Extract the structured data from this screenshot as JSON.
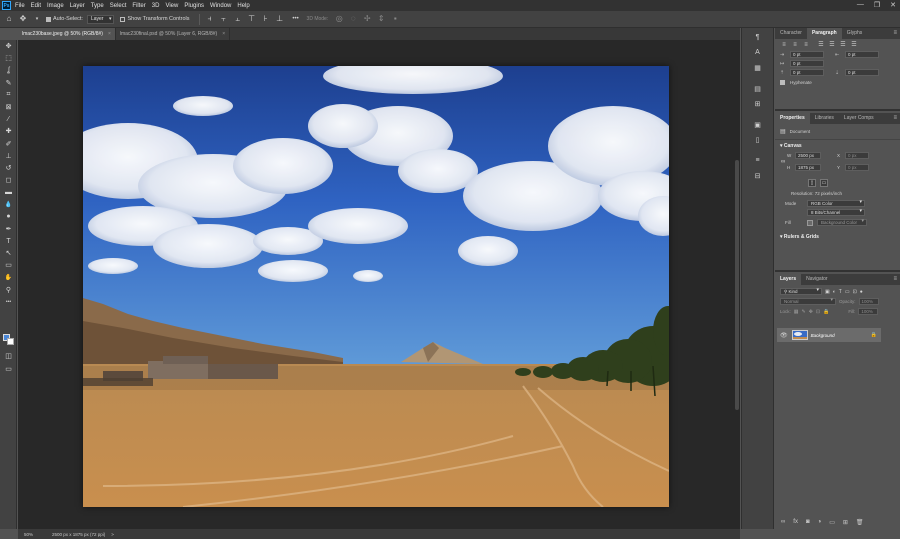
{
  "menu": [
    "File",
    "Edit",
    "Image",
    "Layer",
    "Type",
    "Select",
    "Filter",
    "3D",
    "View",
    "Plugins",
    "Window",
    "Help"
  ],
  "app_logo": "Ps",
  "window_controls": [
    "—",
    "❐",
    "✕"
  ],
  "options": {
    "auto_select": "Auto-Select:",
    "layer_value": "Layer",
    "show_transform": "Show Transform Controls",
    "three_d_mode": "3D Mode:",
    "ellipsis": "•••"
  },
  "tabs": [
    {
      "label": "lmac230base.jpeg @ 50% (RGB/8#)",
      "close": "×"
    },
    {
      "label": "lmac230final.psd @ 50% (Layer 6, RGB/8#)",
      "close": "×"
    }
  ],
  "tools": [
    "move",
    "marquee",
    "lasso",
    "quick-select",
    "crop",
    "frame",
    "eyedropper",
    "healing",
    "brush",
    "stamp",
    "history-brush",
    "eraser",
    "gradient",
    "blur",
    "dodge",
    "pen",
    "type",
    "path-select",
    "rectangle",
    "hand",
    "zoom",
    "more"
  ],
  "tool_glyphs": [
    "✥",
    "⬚",
    "ʆ",
    "✎",
    "⌗",
    "⊠",
    "⁄",
    "✚",
    "✐",
    "⊥",
    "↺",
    "◻",
    "▬",
    "💧",
    "●",
    "✒",
    "T",
    "↖",
    "▭",
    "✋",
    "⚲",
    "•••"
  ],
  "icon_strip": [
    "¶",
    "A",
    "▦",
    "▤",
    "⊞",
    "▣",
    "▯",
    "≡",
    "⊟"
  ],
  "panel_tabs_top": [
    "Character",
    "Paragraph",
    "Glyphs"
  ],
  "paragraph": {
    "fields": [
      "0 pt",
      "0 pt",
      "0 pt",
      "0 pt",
      "0 pt"
    ],
    "hyphenate": "Hyphenate"
  },
  "panel_tabs_props": [
    "Properties",
    "Libraries",
    "Layer Comps"
  ],
  "properties": {
    "document_label": "Document",
    "canvas_title": "Canvas",
    "w": "W",
    "h": "H",
    "x": "X",
    "y": "Y",
    "width": "2500 px",
    "height": "1875 px",
    "x_value": "0 px",
    "y_value": "0 px",
    "resolution": "Resolution: 72 pixels/inch",
    "mode_label": "Mode",
    "mode_value": "RGB Color",
    "depth_value": "8 Bits/Channel",
    "fill_label": "Fill",
    "fill_value": "Background Color",
    "rulers_title": "Rulers & Grids"
  },
  "panel_tabs_layers": [
    "Layers",
    "Navigator"
  ],
  "layers": {
    "kind": "Kind",
    "blend": "Normal",
    "opacity_label": "Opacity:",
    "opacity_value": "100%",
    "lock_label": "Lock:",
    "fill_label": "Fill:",
    "fill_value": "100%",
    "items": [
      {
        "name": "Background"
      }
    ]
  },
  "status": {
    "zoom": "50%",
    "doc_size": "2500 px x 1875 px (72 ppi)",
    "arrow": ">"
  }
}
